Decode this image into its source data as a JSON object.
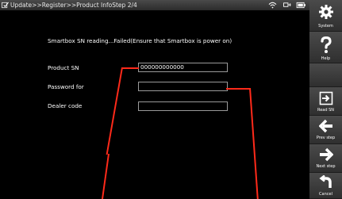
{
  "header": {
    "title": "Update>>Register>>Product InfoStep 2/4"
  },
  "main": {
    "status_message": "Smartbox SN reading...Failed(Ensure that Smartbox is power on)",
    "fields": [
      {
        "label": "Product SN",
        "value": "000000000000"
      },
      {
        "label": "Password for",
        "value": ""
      },
      {
        "label": "Dealer code",
        "value": ""
      }
    ]
  },
  "sidebar": {
    "system": "System",
    "help": "Help",
    "read_sn": "Read SN",
    "prev_step": "Prev step",
    "next_step": "Next step",
    "cancel": "Cancel"
  },
  "colors": {
    "accent_line": "#ff2a1a",
    "background": "#000000",
    "sidebar": "#3a3a3a"
  }
}
